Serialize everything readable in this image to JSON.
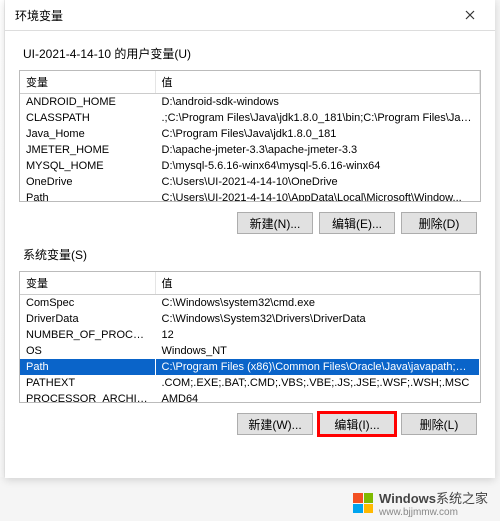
{
  "dialog": {
    "title": "环境变量",
    "user_section_label": "UI-2021-4-14-10 的用户变量(U)",
    "sys_section_label": "系统变量(S)"
  },
  "headers": {
    "var": "变量",
    "val": "值"
  },
  "user_vars": [
    {
      "name": "ANDROID_HOME",
      "value": "D:\\android-sdk-windows"
    },
    {
      "name": "CLASSPATH",
      "value": ".;C:\\Program Files\\Java\\jdk1.8.0_181\\bin;C:\\Program Files\\Jav..."
    },
    {
      "name": "Java_Home",
      "value": "C:\\Program Files\\Java\\jdk1.8.0_181"
    },
    {
      "name": "JMETER_HOME",
      "value": "D:\\apache-jmeter-3.3\\apache-jmeter-3.3"
    },
    {
      "name": "MYSQL_HOME",
      "value": "D:\\mysql-5.6.16-winx64\\mysql-5.6.16-winx64"
    },
    {
      "name": "OneDrive",
      "value": "C:\\Users\\UI-2021-4-14-10\\OneDrive"
    },
    {
      "name": "Path",
      "value": "C:\\Users\\UI-2021-4-14-10\\AppData\\Local\\Microsoft\\Window..."
    }
  ],
  "sys_vars": [
    {
      "name": "ComSpec",
      "value": "C:\\Windows\\system32\\cmd.exe"
    },
    {
      "name": "DriverData",
      "value": "C:\\Windows\\System32\\Drivers\\DriverData"
    },
    {
      "name": "NUMBER_OF_PROCESSORS",
      "value": "12"
    },
    {
      "name": "OS",
      "value": "Windows_NT"
    },
    {
      "name": "Path",
      "value": "C:\\Program Files (x86)\\Common Files\\Oracle\\Java\\javapath;C:..."
    },
    {
      "name": "PATHEXT",
      "value": ".COM;.EXE;.BAT;.CMD;.VBS;.VBE;.JS;.JSE;.WSF;.WSH;.MSC"
    },
    {
      "name": "PROCESSOR_ARCHITECT...",
      "value": "AMD64"
    }
  ],
  "sys_selected_index": 4,
  "buttons": {
    "user_new": "新建(N)...",
    "user_edit": "编辑(E)...",
    "user_delete": "删除(D)",
    "sys_new": "新建(W)...",
    "sys_edit": "编辑(I)...",
    "sys_delete": "删除(L)"
  },
  "watermark": {
    "brand": "Windows",
    "site": "系统之家",
    "url": "www.bjjmmw.com"
  }
}
